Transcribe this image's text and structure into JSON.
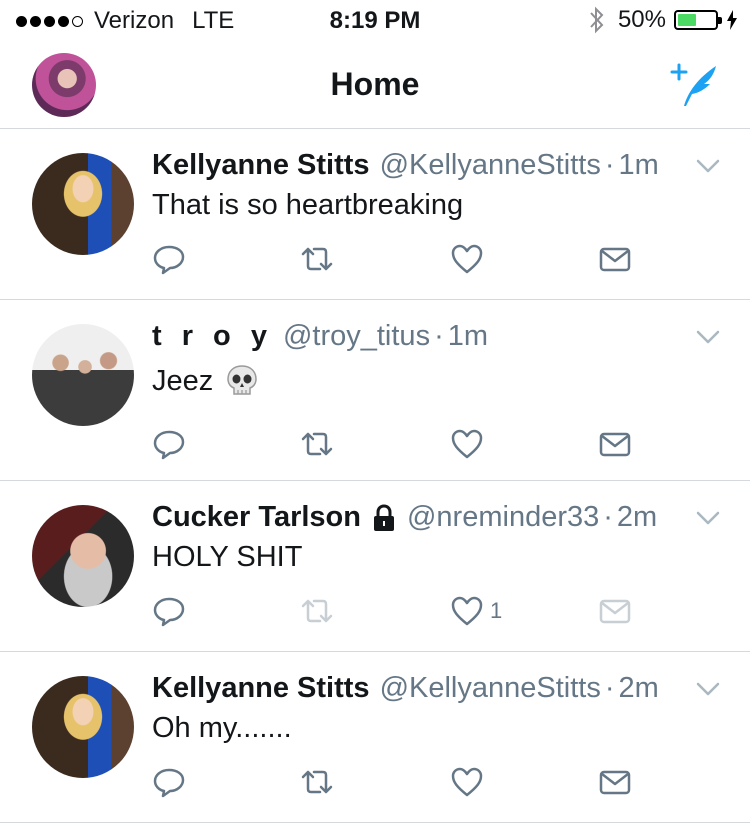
{
  "status_bar": {
    "signal_dots_filled": 4,
    "signal_dots_total": 5,
    "carrier": "Verizon",
    "network": "LTE",
    "time": "8:19 PM",
    "battery_percent": "50%",
    "battery_level": 0.5,
    "battery_color": "#4cd964"
  },
  "nav": {
    "title": "Home",
    "compose_icon": "compose-tweet-icon",
    "accent": "#1da1f2"
  },
  "tweets": [
    {
      "name": "Kellyanne Stitts",
      "handle": "@KellyanneStitts",
      "separator": "·",
      "time": "1m",
      "text": "That is so heartbreaking",
      "likes": ""
    },
    {
      "name": "t r o y",
      "handle": "@troy_titus",
      "separator": "·",
      "time": "1m",
      "text": "Jeez",
      "emoji": "skull-icon",
      "likes": ""
    },
    {
      "name": "Cucker Tarlson",
      "protected": true,
      "handle": "@nreminder33",
      "separator": "·",
      "time": "2m",
      "text": "HOLY SHIT",
      "likes": "1"
    },
    {
      "name": "Kellyanne Stitts",
      "handle": "@KellyanneStitts",
      "separator": "·",
      "time": "2m",
      "text": "Oh my.......",
      "likes": ""
    }
  ]
}
